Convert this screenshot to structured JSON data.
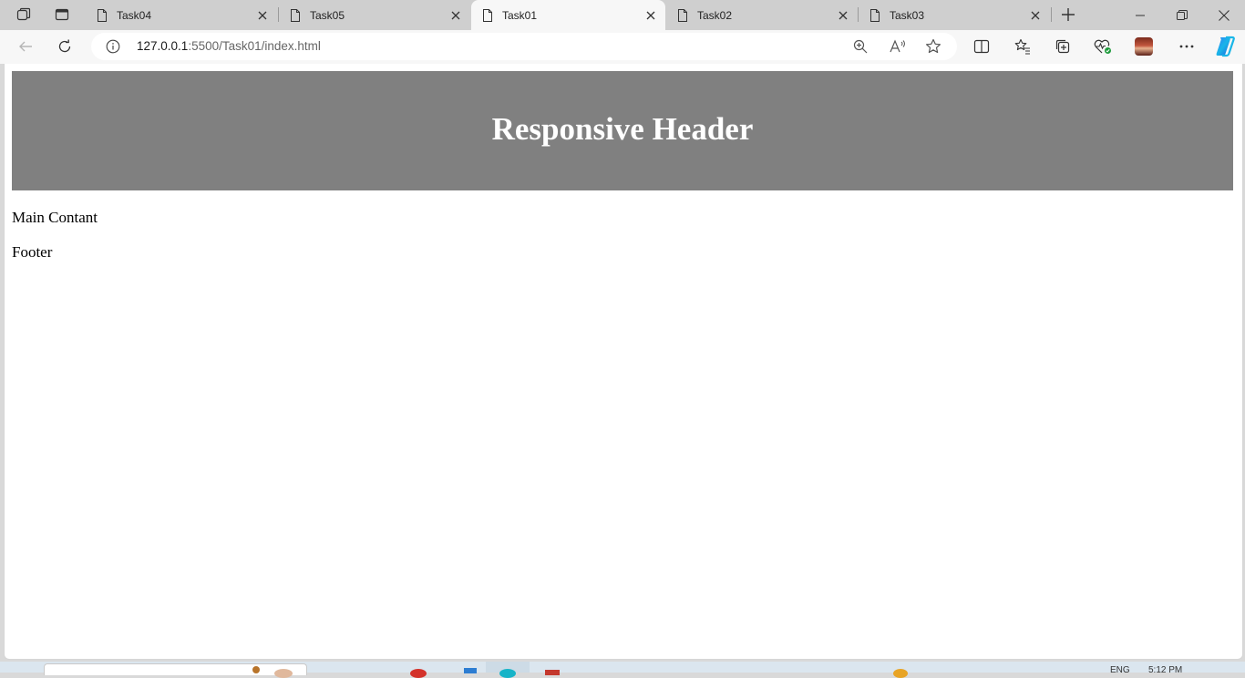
{
  "browser": {
    "tabs": [
      {
        "label": "Task04",
        "active": false
      },
      {
        "label": "Task05",
        "active": false
      },
      {
        "label": "Task01",
        "active": true
      },
      {
        "label": "Task02",
        "active": false
      },
      {
        "label": "Task03",
        "active": false
      }
    ],
    "address": {
      "host": "127.0.0.1",
      "path": ":5500/Task01/index.html"
    }
  },
  "page": {
    "header_title": "Responsive Header",
    "main_text": "Main Contant",
    "footer_text": "Footer"
  },
  "taskbar": {
    "language": "ENG",
    "time": "5:12 PM"
  },
  "colors": {
    "header_bg": "#808080",
    "header_text": "#ffffff",
    "copilot_accent": "#2f7df6"
  }
}
